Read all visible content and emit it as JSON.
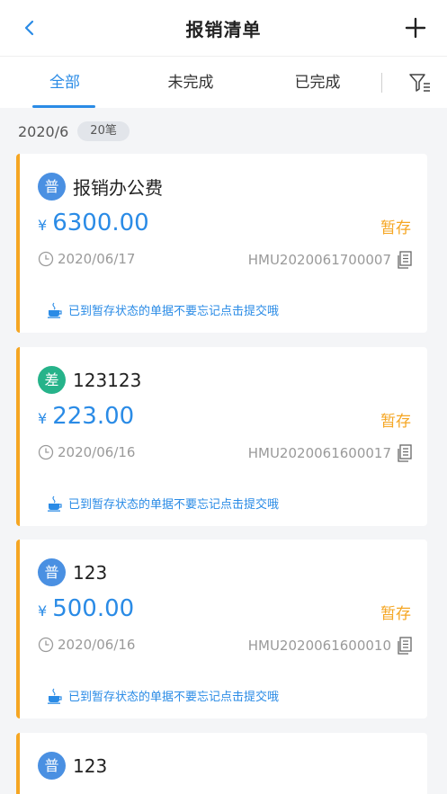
{
  "header": {
    "title": "报销清单"
  },
  "tabs": [
    {
      "label": "全部",
      "active": true
    },
    {
      "label": "未完成",
      "active": false
    },
    {
      "label": "已完成",
      "active": false
    }
  ],
  "group": {
    "date": "2020/6",
    "count": "20笔"
  },
  "cards": [
    {
      "avatar": "普",
      "avatar_color": "#4a90e2",
      "name": "报销办公费",
      "currency": "¥",
      "amount": "6300.00",
      "status": "暂存",
      "date": "2020/06/17",
      "code": "HMU2020061700007",
      "tip": "已到暂存状态的单据不要忘记点击提交哦"
    },
    {
      "avatar": "差",
      "avatar_color": "#26b38a",
      "name": "123123",
      "currency": "¥",
      "amount": "223.00",
      "status": "暂存",
      "date": "2020/06/16",
      "code": "HMU2020061600017",
      "tip": "已到暂存状态的单据不要忘记点击提交哦"
    },
    {
      "avatar": "普",
      "avatar_color": "#4a90e2",
      "name": "123",
      "currency": "¥",
      "amount": "500.00",
      "status": "暂存",
      "date": "2020/06/16",
      "code": "HMU2020061600010",
      "tip": "已到暂存状态的单据不要忘记点击提交哦"
    },
    {
      "avatar": "普",
      "avatar_color": "#4a90e2",
      "name": "123"
    }
  ],
  "colors": {
    "accent": "#2a8be6",
    "warning": "#f5a623"
  }
}
